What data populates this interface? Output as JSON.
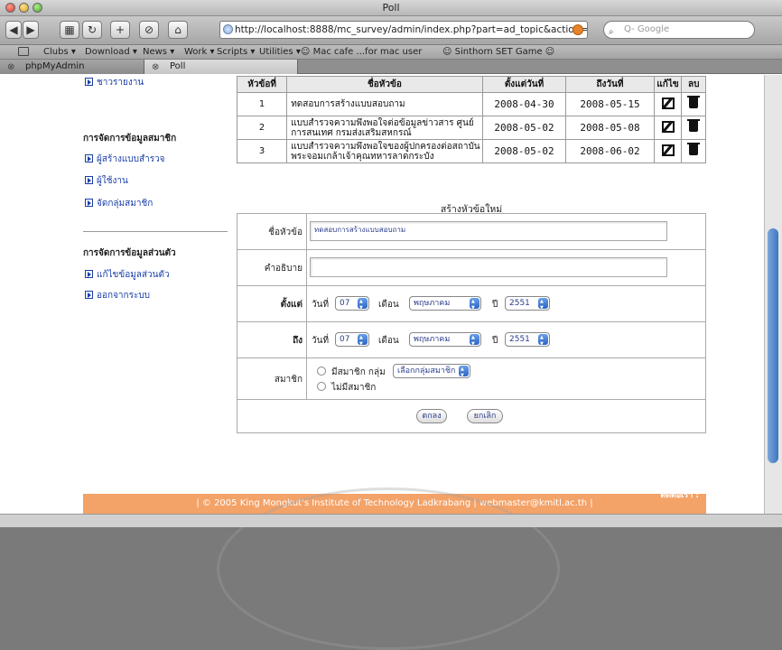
{
  "window": {
    "title": "Poll"
  },
  "toolbar": {
    "back": "◀",
    "forward": "▶",
    "print": "▦",
    "reload": "↻",
    "add": "+",
    "stop": "⊘",
    "home": "⌂",
    "url": "http://localhost:8888/mc_survey/admin/index.php?part=ad_topic&action=",
    "search_placeholder": "Q- Google"
  },
  "bookmarks": [
    "Clubs ▾",
    "Download ▾",
    "News ▾",
    "Work ▾",
    "Scripts ▾",
    "Utilities ▾",
    "☺ Mac cafe ...for mac user",
    "☺ Sinthorn SET Game ☺"
  ],
  "tabs": [
    {
      "label": "phpMyAdmin"
    },
    {
      "label": "Poll"
    }
  ],
  "sidebar": {
    "top_link": "ชาวรายงาน",
    "section1_title": "การจัดการข้อมูลสมาชิก",
    "section1_items": [
      "ผู้สร้างแบบสำรวจ",
      "ผู้ใช้งาน",
      "จัดกลุ่มสมาชิก"
    ],
    "section2_title": "การจัดการข้อมูลส่วนตัว",
    "section2_items": [
      "แก้ไขข้อมูลส่วนตัว",
      "ออกจากระบบ"
    ]
  },
  "topics_table": {
    "headers": [
      "หัวข้อที่",
      "ชื่อหัวข้อ",
      "ตั้งแต่วันที่",
      "ถึงวันที่",
      "แก้ไข",
      "ลบ"
    ],
    "rows": [
      {
        "no": "1",
        "topic": "ทดสอบการสร้างแบบสอบถาม",
        "start": "2008-04-30",
        "end": "2008-05-15"
      },
      {
        "no": "2",
        "topic": "แบบสำรวจความพึงพอใจต่อข้อมูลข่าวสาร ศูนย์การสนเทศ กรมส่งเสริมสหกรณ์",
        "start": "2008-05-02",
        "end": "2008-05-08"
      },
      {
        "no": "3",
        "topic": "แบบสำรวจความพึงพอใจของผู้ปกครองต่อสถาบันพระจอมเกล้าเจ้าคุณทหารลาดกระบัง",
        "start": "2008-05-02",
        "end": "2008-06-02"
      }
    ]
  },
  "form": {
    "title": "สร้างหัวข้อใหม่",
    "topic_label": "ชื่อหัวข้อ",
    "topic_value": "ทดสอบการสร้างแบบสอบถาม",
    "desc_label": "คำอธิบาย",
    "desc_value": "",
    "start_label": "ตั้งแต่",
    "end_label": "ถึง",
    "day_label": "วันที่",
    "month_label": "เดือน",
    "year_label": "ปี",
    "start_day": "07",
    "start_month": "พฤษภาคม",
    "start_year": "2551",
    "end_day": "07",
    "end_month": "พฤษภาคม",
    "end_year": "2551",
    "member_label": "สมาชิก",
    "member_option1": "มีสมาชิก กลุ่ม",
    "member_group_select": "เลือกกลุ่มสมาชิก",
    "member_option2": "ไม่มีสมาชิก",
    "submit": "ตกลง",
    "cancel": "ยกเลิก"
  },
  "footer": {
    "text": "| © 2005 King Mongkut's Institute of Technology Ladkrabang | webmaster@kmitl.ac.th |",
    "right": "ติดต่อเรา :"
  },
  "colors": {
    "footer": "#f3a268",
    "link": "#1a3ea8"
  }
}
